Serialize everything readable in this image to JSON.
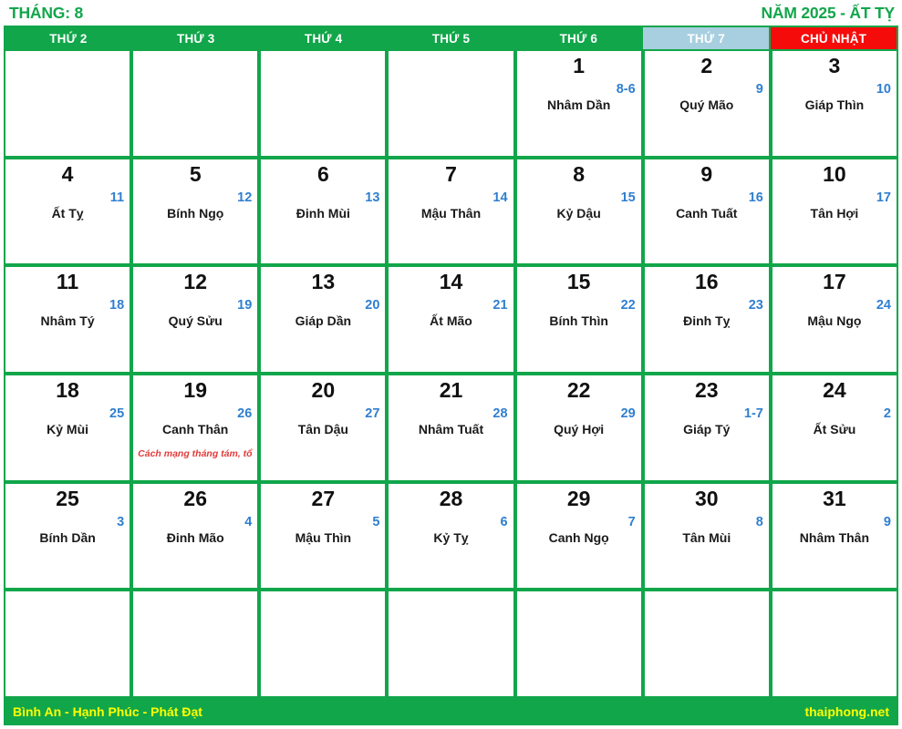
{
  "header": {
    "month_label": "THÁNG: 8",
    "year_label": "NĂM 2025 - ẤT TỴ"
  },
  "colors": {
    "green": "#11a64a",
    "saturday_bg": "#a7cfdf",
    "sunday_bg": "#f60b0b",
    "lunar_blue": "#2f7fd0",
    "event_red": "#e23b3b",
    "footer_text": "#ffff00"
  },
  "weekdays": [
    {
      "label": "THỨ 2",
      "kind": "weekday"
    },
    {
      "label": "THỨ 3",
      "kind": "weekday"
    },
    {
      "label": "THỨ 4",
      "kind": "weekday"
    },
    {
      "label": "THỨ 5",
      "kind": "weekday"
    },
    {
      "label": "THỨ 6",
      "kind": "weekday"
    },
    {
      "label": "THỨ 7",
      "kind": "saturday"
    },
    {
      "label": "CHỦ NHẬT",
      "kind": "sunday"
    }
  ],
  "weeks": [
    [
      {
        "solar": "",
        "lunar": "",
        "canchi": "",
        "event": ""
      },
      {
        "solar": "",
        "lunar": "",
        "canchi": "",
        "event": ""
      },
      {
        "solar": "",
        "lunar": "",
        "canchi": "",
        "event": ""
      },
      {
        "solar": "",
        "lunar": "",
        "canchi": "",
        "event": ""
      },
      {
        "solar": "1",
        "lunar": "8-6",
        "canchi": "Nhâm Dần",
        "event": ""
      },
      {
        "solar": "2",
        "lunar": "9",
        "canchi": "Quý Mão",
        "event": ""
      },
      {
        "solar": "3",
        "lunar": "10",
        "canchi": "Giáp Thìn",
        "event": ""
      }
    ],
    [
      {
        "solar": "4",
        "lunar": "11",
        "canchi": "Ất Tỵ",
        "event": ""
      },
      {
        "solar": "5",
        "lunar": "12",
        "canchi": "Bính Ngọ",
        "event": ""
      },
      {
        "solar": "6",
        "lunar": "13",
        "canchi": "Đinh Mùi",
        "event": ""
      },
      {
        "solar": "7",
        "lunar": "14",
        "canchi": "Mậu Thân",
        "event": ""
      },
      {
        "solar": "8",
        "lunar": "15",
        "canchi": "Kỷ Dậu",
        "event": ""
      },
      {
        "solar": "9",
        "lunar": "16",
        "canchi": "Canh Tuất",
        "event": ""
      },
      {
        "solar": "10",
        "lunar": "17",
        "canchi": "Tân Hợi",
        "event": ""
      }
    ],
    [
      {
        "solar": "11",
        "lunar": "18",
        "canchi": "Nhâm Tý",
        "event": ""
      },
      {
        "solar": "12",
        "lunar": "19",
        "canchi": "Quý Sửu",
        "event": ""
      },
      {
        "solar": "13",
        "lunar": "20",
        "canchi": "Giáp Dần",
        "event": ""
      },
      {
        "solar": "14",
        "lunar": "21",
        "canchi": "Ất Mão",
        "event": ""
      },
      {
        "solar": "15",
        "lunar": "22",
        "canchi": "Bính Thìn",
        "event": ""
      },
      {
        "solar": "16",
        "lunar": "23",
        "canchi": "Đinh Tỵ",
        "event": ""
      },
      {
        "solar": "17",
        "lunar": "24",
        "canchi": "Mậu Ngọ",
        "event": ""
      }
    ],
    [
      {
        "solar": "18",
        "lunar": "25",
        "canchi": "Kỷ Mùi",
        "event": ""
      },
      {
        "solar": "19",
        "lunar": "26",
        "canchi": "Canh Thân",
        "event": "Cách mạng tháng tám, tổ"
      },
      {
        "solar": "20",
        "lunar": "27",
        "canchi": "Tân Dậu",
        "event": ""
      },
      {
        "solar": "21",
        "lunar": "28",
        "canchi": "Nhâm Tuất",
        "event": ""
      },
      {
        "solar": "22",
        "lunar": "29",
        "canchi": "Quý Hợi",
        "event": ""
      },
      {
        "solar": "23",
        "lunar": "1-7",
        "canchi": "Giáp Tý",
        "event": ""
      },
      {
        "solar": "24",
        "lunar": "2",
        "canchi": "Ất Sửu",
        "event": ""
      }
    ],
    [
      {
        "solar": "25",
        "lunar": "3",
        "canchi": "Bính Dần",
        "event": ""
      },
      {
        "solar": "26",
        "lunar": "4",
        "canchi": "Đinh Mão",
        "event": ""
      },
      {
        "solar": "27",
        "lunar": "5",
        "canchi": "Mậu Thìn",
        "event": ""
      },
      {
        "solar": "28",
        "lunar": "6",
        "canchi": "Kỷ Tỵ",
        "event": ""
      },
      {
        "solar": "29",
        "lunar": "7",
        "canchi": "Canh Ngọ",
        "event": ""
      },
      {
        "solar": "30",
        "lunar": "8",
        "canchi": "Tân Mùi",
        "event": ""
      },
      {
        "solar": "31",
        "lunar": "9",
        "canchi": "Nhâm Thân",
        "event": ""
      }
    ],
    [
      {
        "solar": "",
        "lunar": "",
        "canchi": "",
        "event": ""
      },
      {
        "solar": "",
        "lunar": "",
        "canchi": "",
        "event": ""
      },
      {
        "solar": "",
        "lunar": "",
        "canchi": "",
        "event": ""
      },
      {
        "solar": "",
        "lunar": "",
        "canchi": "",
        "event": ""
      },
      {
        "solar": "",
        "lunar": "",
        "canchi": "",
        "event": ""
      },
      {
        "solar": "",
        "lunar": "",
        "canchi": "",
        "event": ""
      },
      {
        "solar": "",
        "lunar": "",
        "canchi": "",
        "event": ""
      }
    ]
  ],
  "footer": {
    "slogan": "Bình An - Hạnh Phúc - Phát Đạt",
    "website": "thaiphong.net"
  }
}
